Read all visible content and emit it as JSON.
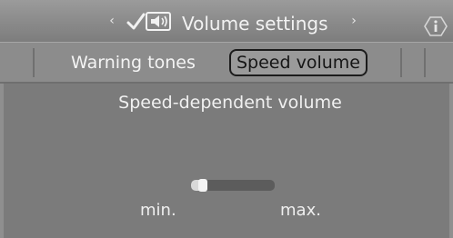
{
  "header": {
    "prev_arrow": "‹",
    "title": "Volume settings",
    "next_arrow": "›",
    "mode_icon": "speaker-settings-icon",
    "info_icon": "info-icon"
  },
  "tabs": [
    {
      "label": "Warning tones",
      "active": false
    },
    {
      "label": "Speed volume",
      "active": true
    }
  ],
  "setting": {
    "title": "Speed-dependent volume",
    "level": 0.1,
    "min_label": "min.",
    "max_label": "max."
  },
  "colors": {
    "title_bar": "#8a8a8a",
    "panel": "#7b7b7b",
    "text": "#f0f0f0",
    "active_tab_border": "#1c1c1c"
  }
}
